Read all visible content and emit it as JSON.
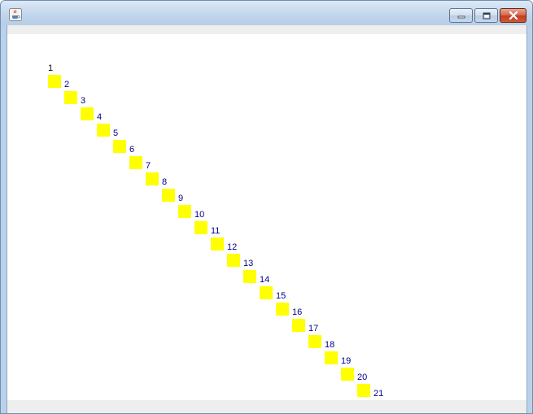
{
  "window": {
    "title": "",
    "icon": "java-coffee-cup-icon",
    "controls": {
      "minimize": "minimize-icon",
      "maximize": "maximize-icon",
      "close": "close-icon",
      "close_color": "#c84a2b"
    }
  },
  "canvas": {
    "background": "#ffffff",
    "square_color": "#ffff00",
    "label_color": "#00008b",
    "items": [
      {
        "label": "1"
      },
      {
        "label": "2"
      },
      {
        "label": "3"
      },
      {
        "label": "4"
      },
      {
        "label": "5"
      },
      {
        "label": "6"
      },
      {
        "label": "7"
      },
      {
        "label": "8"
      },
      {
        "label": "9"
      },
      {
        "label": "10"
      },
      {
        "label": "11"
      },
      {
        "label": "12"
      },
      {
        "label": "13"
      },
      {
        "label": "14"
      },
      {
        "label": "15"
      },
      {
        "label": "16"
      },
      {
        "label": "17"
      },
      {
        "label": "18"
      },
      {
        "label": "19"
      },
      {
        "label": "20"
      },
      {
        "label": "21"
      }
    ]
  }
}
